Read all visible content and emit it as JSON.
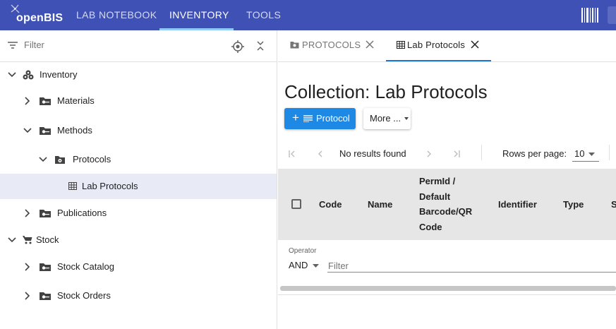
{
  "app": {
    "logo_text": "openBIS",
    "nav_tabs": [
      "LAB NOTEBOOK",
      "INVENTORY",
      "TOOLS"
    ],
    "active_nav": "INVENTORY"
  },
  "sidebar": {
    "filter_placeholder": "Filter",
    "tree": [
      {
        "label": "Inventory",
        "icon": "inventory-icon",
        "expanded": true
      },
      {
        "label": "Materials",
        "icon": "space-folder-icon",
        "expanded": false
      },
      {
        "label": "Methods",
        "icon": "space-folder-icon",
        "expanded": true
      },
      {
        "label": "Protocols",
        "icon": "project-folder-icon",
        "expanded": true
      },
      {
        "label": "Lab Protocols",
        "icon": "collection-table-icon",
        "selected": true
      },
      {
        "label": "Publications",
        "icon": "space-folder-icon",
        "expanded": false
      },
      {
        "label": "Stock",
        "icon": "cart-icon",
        "expanded": true
      },
      {
        "label": "Stock Catalog",
        "icon": "space-folder-icon",
        "expanded": false
      },
      {
        "label": "Stock Orders",
        "icon": "space-folder-icon",
        "expanded": false
      }
    ]
  },
  "content": {
    "tabs": [
      {
        "label": "PROTOCOLS",
        "icon": "project-folder-icon"
      },
      {
        "label": "Lab Protocols",
        "icon": "collection-table-icon",
        "active": true
      }
    ],
    "title": "Collection: Lab Protocols",
    "primary_button": "Protocol",
    "more_button": "More ...",
    "pager": {
      "status": "No results found",
      "rows_per_page_label": "Rows per page:",
      "rows_per_page_value": "10"
    },
    "columns": [
      "Code",
      "Name",
      "PermId /",
      "Default",
      "Barcode/QR",
      "Code",
      "Identifier",
      "Type",
      "S"
    ],
    "operator_label": "Operator",
    "operator_value": "AND",
    "filter_placeholder": "Filter"
  },
  "colors": {
    "topbar": "#3f51b5",
    "primary_button": "#1e88e5",
    "selected_row": "#e8eaf6",
    "grid_header": "#e6e6e6"
  }
}
